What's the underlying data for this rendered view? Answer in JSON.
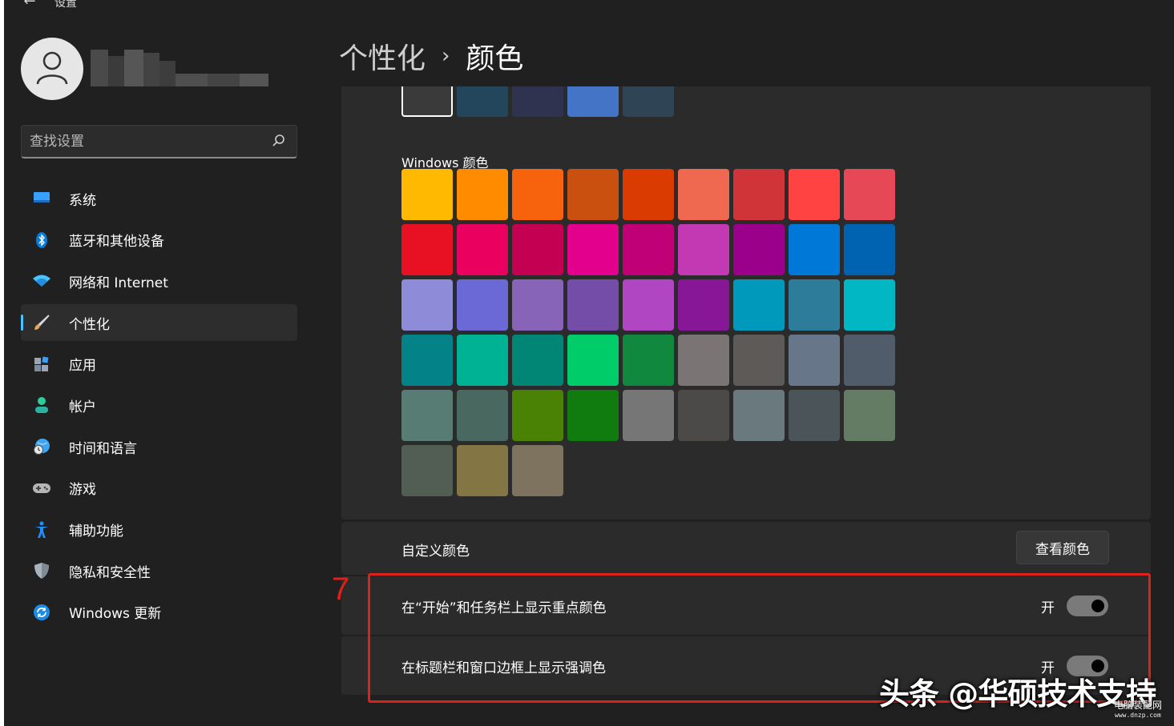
{
  "window": {
    "title": "设置"
  },
  "search": {
    "placeholder": "查找设置"
  },
  "sidebar": {
    "items": [
      {
        "label": "系统",
        "icon": "monitor-icon",
        "color": "#3aa0ff"
      },
      {
        "label": "蓝牙和其他设备",
        "icon": "bluetooth-icon",
        "color": "#0a7bd6"
      },
      {
        "label": "网络和 Internet",
        "icon": "wifi-icon",
        "color": "#4cc2ff"
      },
      {
        "label": "个性化",
        "icon": "brush-icon",
        "color": "#e9a65b",
        "active": true
      },
      {
        "label": "应用",
        "icon": "apps-icon",
        "color": "#9aa6b8"
      },
      {
        "label": "帐户",
        "icon": "person-icon",
        "color": "#2ecc9a"
      },
      {
        "label": "时间和语言",
        "icon": "globe-clock-icon",
        "color": "#3da5f5"
      },
      {
        "label": "游戏",
        "icon": "gamepad-icon",
        "color": "#b5b5b5"
      },
      {
        "label": "辅助功能",
        "icon": "accessibility-icon",
        "color": "#1e90ff"
      },
      {
        "label": "隐私和安全性",
        "icon": "shield-icon",
        "color": "#a9b3bd"
      },
      {
        "label": "Windows 更新",
        "icon": "sync-icon",
        "color": "#1a8ce8"
      }
    ]
  },
  "breadcrumb": {
    "parent": "个性化",
    "separator": "›",
    "current": "颜色"
  },
  "colors": {
    "recent": [
      "#3a3a3a",
      "#23465d",
      "#2f3350",
      "#4474c6",
      "#2f4454"
    ],
    "windows_label": "Windows 颜色",
    "windows_colors": [
      "#ffb900",
      "#ff8c00",
      "#f7630c",
      "#ca5010",
      "#da3b01",
      "#ef6950",
      "#d13438",
      "#ff4343",
      "#e74856",
      "#e81123",
      "#ea005e",
      "#c30052",
      "#e3008c",
      "#bf0077",
      "#c239b3",
      "#9a0089",
      "#0078d7",
      "#0063b1",
      "#8e8cd8",
      "#6b69d6",
      "#8764b8",
      "#744da9",
      "#b146c2",
      "#881798",
      "#0099bc",
      "#2d7d9a",
      "#00b7c3",
      "#038387",
      "#00b294",
      "#018574",
      "#00cc6a",
      "#10893e",
      "#7a7574",
      "#5d5a58",
      "#68768a",
      "#515c6b",
      "#567c73",
      "#486860",
      "#498205",
      "#107c10",
      "#767676",
      "#4c4a48",
      "#69797e",
      "#4a5459",
      "#647c64",
      "#525e54",
      "#847545",
      "#7e735f"
    ]
  },
  "custom": {
    "label": "自定义颜色",
    "button": "查看颜色"
  },
  "toggles": {
    "start_taskbar": {
      "label": "在“开始”和任务栏上显示重点颜色",
      "state": "开"
    },
    "title_bars": {
      "label": "在标题栏和窗口边框上显示强调色",
      "state": "开"
    }
  },
  "annotation": {
    "number": "7",
    "color": "#e0201a"
  },
  "watermark": {
    "text": "头条 @华硕技术支持",
    "site": "电脑装配网",
    "url": "www.dnzp.com"
  },
  "accent": "#4cc2ff"
}
